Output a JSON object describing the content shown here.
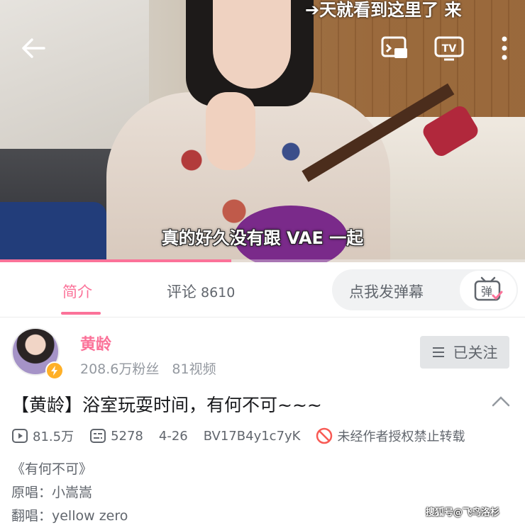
{
  "player": {
    "top_overlay_text": "➔天就看到这里了  来",
    "subtitle": "真的好久没有跟 VAE 一起",
    "progress": 0.44,
    "icons": [
      "back-arrow-icon",
      "cast-screen-icon",
      "tv-icon",
      "more-vertical-icon"
    ]
  },
  "tabs": {
    "intro": "简介",
    "comments": "评论",
    "comments_count": "8610",
    "danmaku_placeholder": "点我发弹幕",
    "danmaku_btn": "弹"
  },
  "uploader": {
    "name": "黄龄",
    "fans": "208.6万粉丝",
    "videos": "81视频",
    "follow_label": "已关注"
  },
  "video": {
    "title": "【黄龄】浴室玩耍时间，有何不可~~~",
    "views": "81.5万",
    "danmaku_count": "5278",
    "date": "4-26",
    "bvid": "BV17B4y1c7yK",
    "copyright": "未经作者授权禁止转载"
  },
  "description": {
    "line1": "《有何不可》",
    "line2": "原唱：小嵩嵩",
    "line3": "翻唱：yellow zero"
  },
  "watermark": "搜狐号@飞鸟洛杉",
  "colors": {
    "accent": "#fb7299",
    "text": "#18191c",
    "secondary": "#61666d"
  }
}
